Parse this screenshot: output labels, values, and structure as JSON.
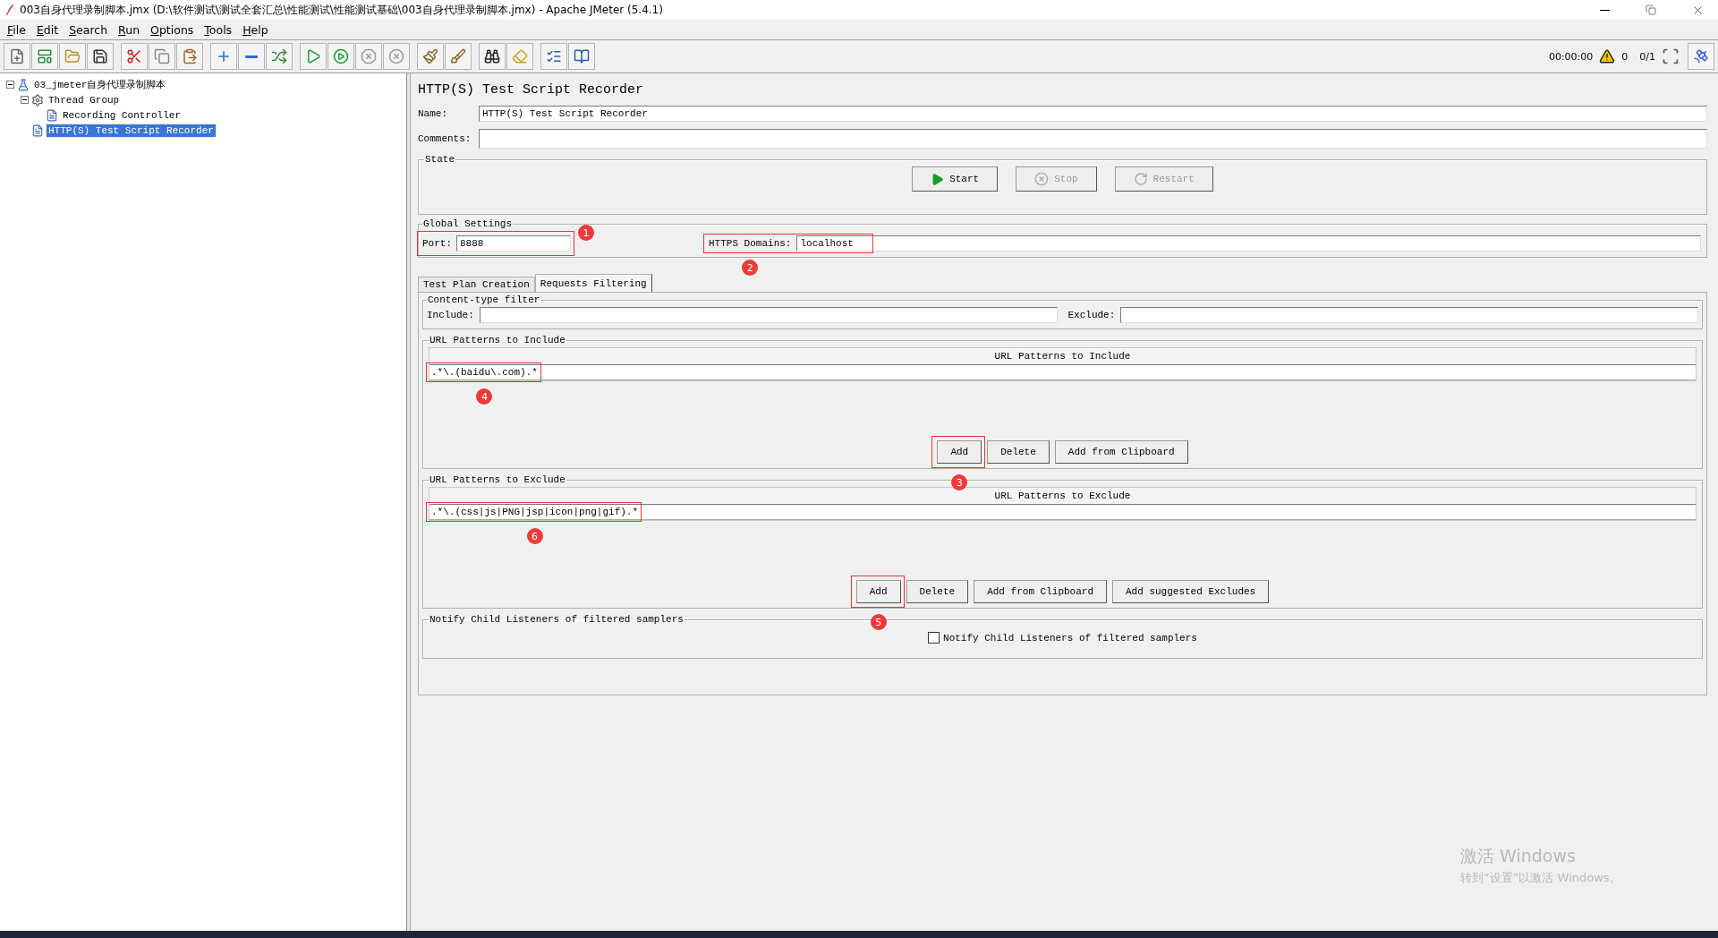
{
  "window": {
    "title": "003自身代理录制脚本.jmx (D:\\软件测试\\测试全套汇总\\性能测试\\性能测试基础\\003自身代理录制脚本.jmx) - Apache JMeter (5.4.1)"
  },
  "menu": [
    {
      "label": "File"
    },
    {
      "label": "Edit"
    },
    {
      "label": "Search"
    },
    {
      "label": "Run"
    },
    {
      "label": "Options"
    },
    {
      "label": "Tools"
    },
    {
      "label": "Help"
    }
  ],
  "toolbar": {
    "timer": "00:00:00",
    "warnings": "0",
    "threads": "0/1"
  },
  "tree": [
    {
      "label": "03_jmeter自身代理录制脚本",
      "kind": "plan",
      "expanded": true,
      "selected": false,
      "children": [
        {
          "label": "Thread Group",
          "kind": "thread_group",
          "expanded": true,
          "selected": false,
          "children": [
            {
              "label": "Recording Controller",
              "kind": "controller",
              "selected": false
            }
          ]
        },
        {
          "label": "HTTP(S) Test Script Recorder",
          "kind": "recorder",
          "selected": true
        }
      ]
    }
  ],
  "editor": {
    "title": "HTTP(S) Test Script Recorder",
    "name_label": "Name:",
    "name_value": "HTTP(S) Test Script Recorder",
    "comments_label": "Comments:",
    "state": {
      "title": "State",
      "buttons": [
        {
          "label": "Start",
          "kind": "start",
          "disabled": false
        },
        {
          "label": "Stop",
          "kind": "stop",
          "disabled": true
        },
        {
          "label": "Restart",
          "kind": "restart",
          "disabled": true
        }
      ]
    },
    "global_settings": {
      "title": "Global Settings",
      "port_label": "Port:",
      "port": "8888",
      "port_callout": "1",
      "https_label": "HTTPS Domains:",
      "https_domains": "localhost",
      "https_callout": "2"
    },
    "tabs": [
      {
        "label": "Test Plan Creation",
        "selected": false
      },
      {
        "label": "Requests Filtering",
        "selected": true
      }
    ],
    "content_type_filter": {
      "title": "Content-type filter",
      "include_label": "Include:",
      "exclude_label": "Exclude:"
    },
    "include_patterns": {
      "title": "URL Patterns to Include",
      "column": "URL Patterns to Include",
      "rows": [
        {
          "pattern": ".*\\.(baidu\\.com).*",
          "callout": "4"
        }
      ],
      "buttons": [
        {
          "label": "Add",
          "callout": "3"
        },
        {
          "label": "Delete"
        },
        {
          "label": "Add from Clipboard"
        }
      ]
    },
    "exclude_patterns": {
      "title": "URL Patterns to Exclude",
      "column": "URL Patterns to Exclude",
      "rows": [
        {
          "pattern": ".*\\.(css|js|PNG|jsp|icon|png|gif).*",
          "callout": "6"
        }
      ],
      "buttons": [
        {
          "label": "Add",
          "callout": "5"
        },
        {
          "label": "Delete"
        },
        {
          "label": "Add from Clipboard"
        },
        {
          "label": "Add suggested Excludes"
        }
      ]
    },
    "notify": {
      "title": "Notify Child Listeners of filtered samplers",
      "checkbox": {
        "label": "Notify Child Listeners of filtered samplers",
        "checked": false
      }
    }
  },
  "activation_notice": {
    "title": "激活 Windows",
    "subtitle": "转到“设置”以激活 Windows。"
  }
}
